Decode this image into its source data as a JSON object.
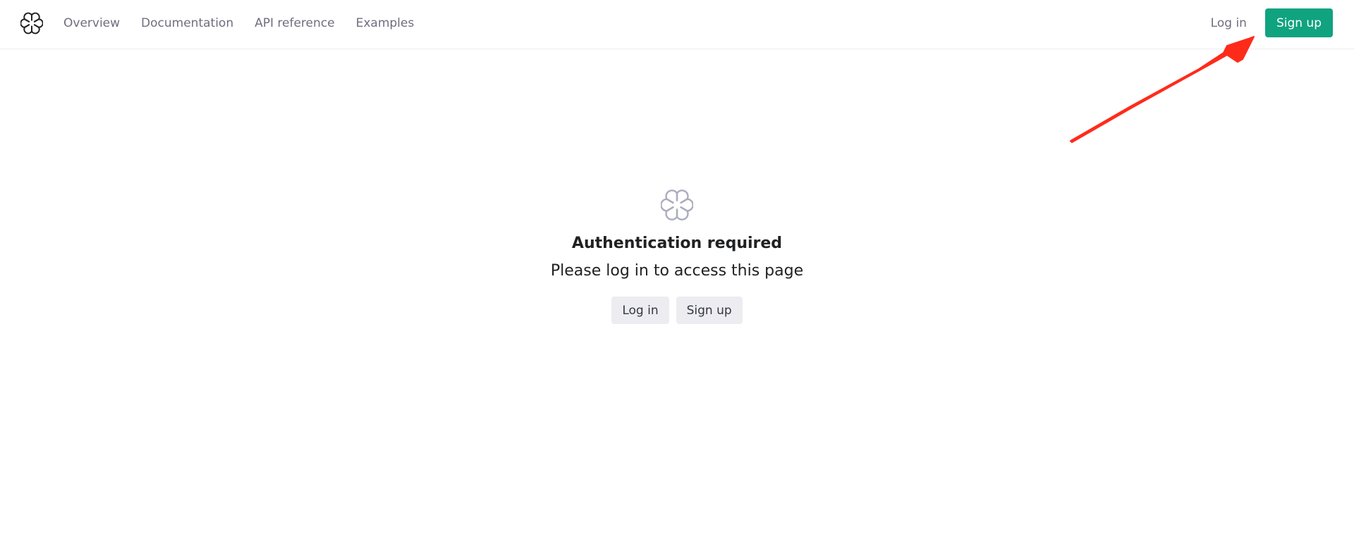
{
  "header": {
    "logo_icon": "openai-logo-icon",
    "nav": [
      {
        "label": "Overview"
      },
      {
        "label": "Documentation"
      },
      {
        "label": "API reference"
      },
      {
        "label": "Examples"
      }
    ],
    "login_label": "Log in",
    "signup_label": "Sign up"
  },
  "auth": {
    "logo_icon": "openai-logo-icon",
    "title": "Authentication required",
    "subtitle": "Please log in to access this page",
    "login_label": "Log in",
    "signup_label": "Sign up"
  },
  "annotation": {
    "icon": "red-arrow-icon",
    "color": "#ff2b1a"
  },
  "colors": {
    "accent": "#10a37f",
    "nav_text": "#6e6e80",
    "neutral_button": "#ececf1",
    "logo_muted": "#acacbe"
  }
}
